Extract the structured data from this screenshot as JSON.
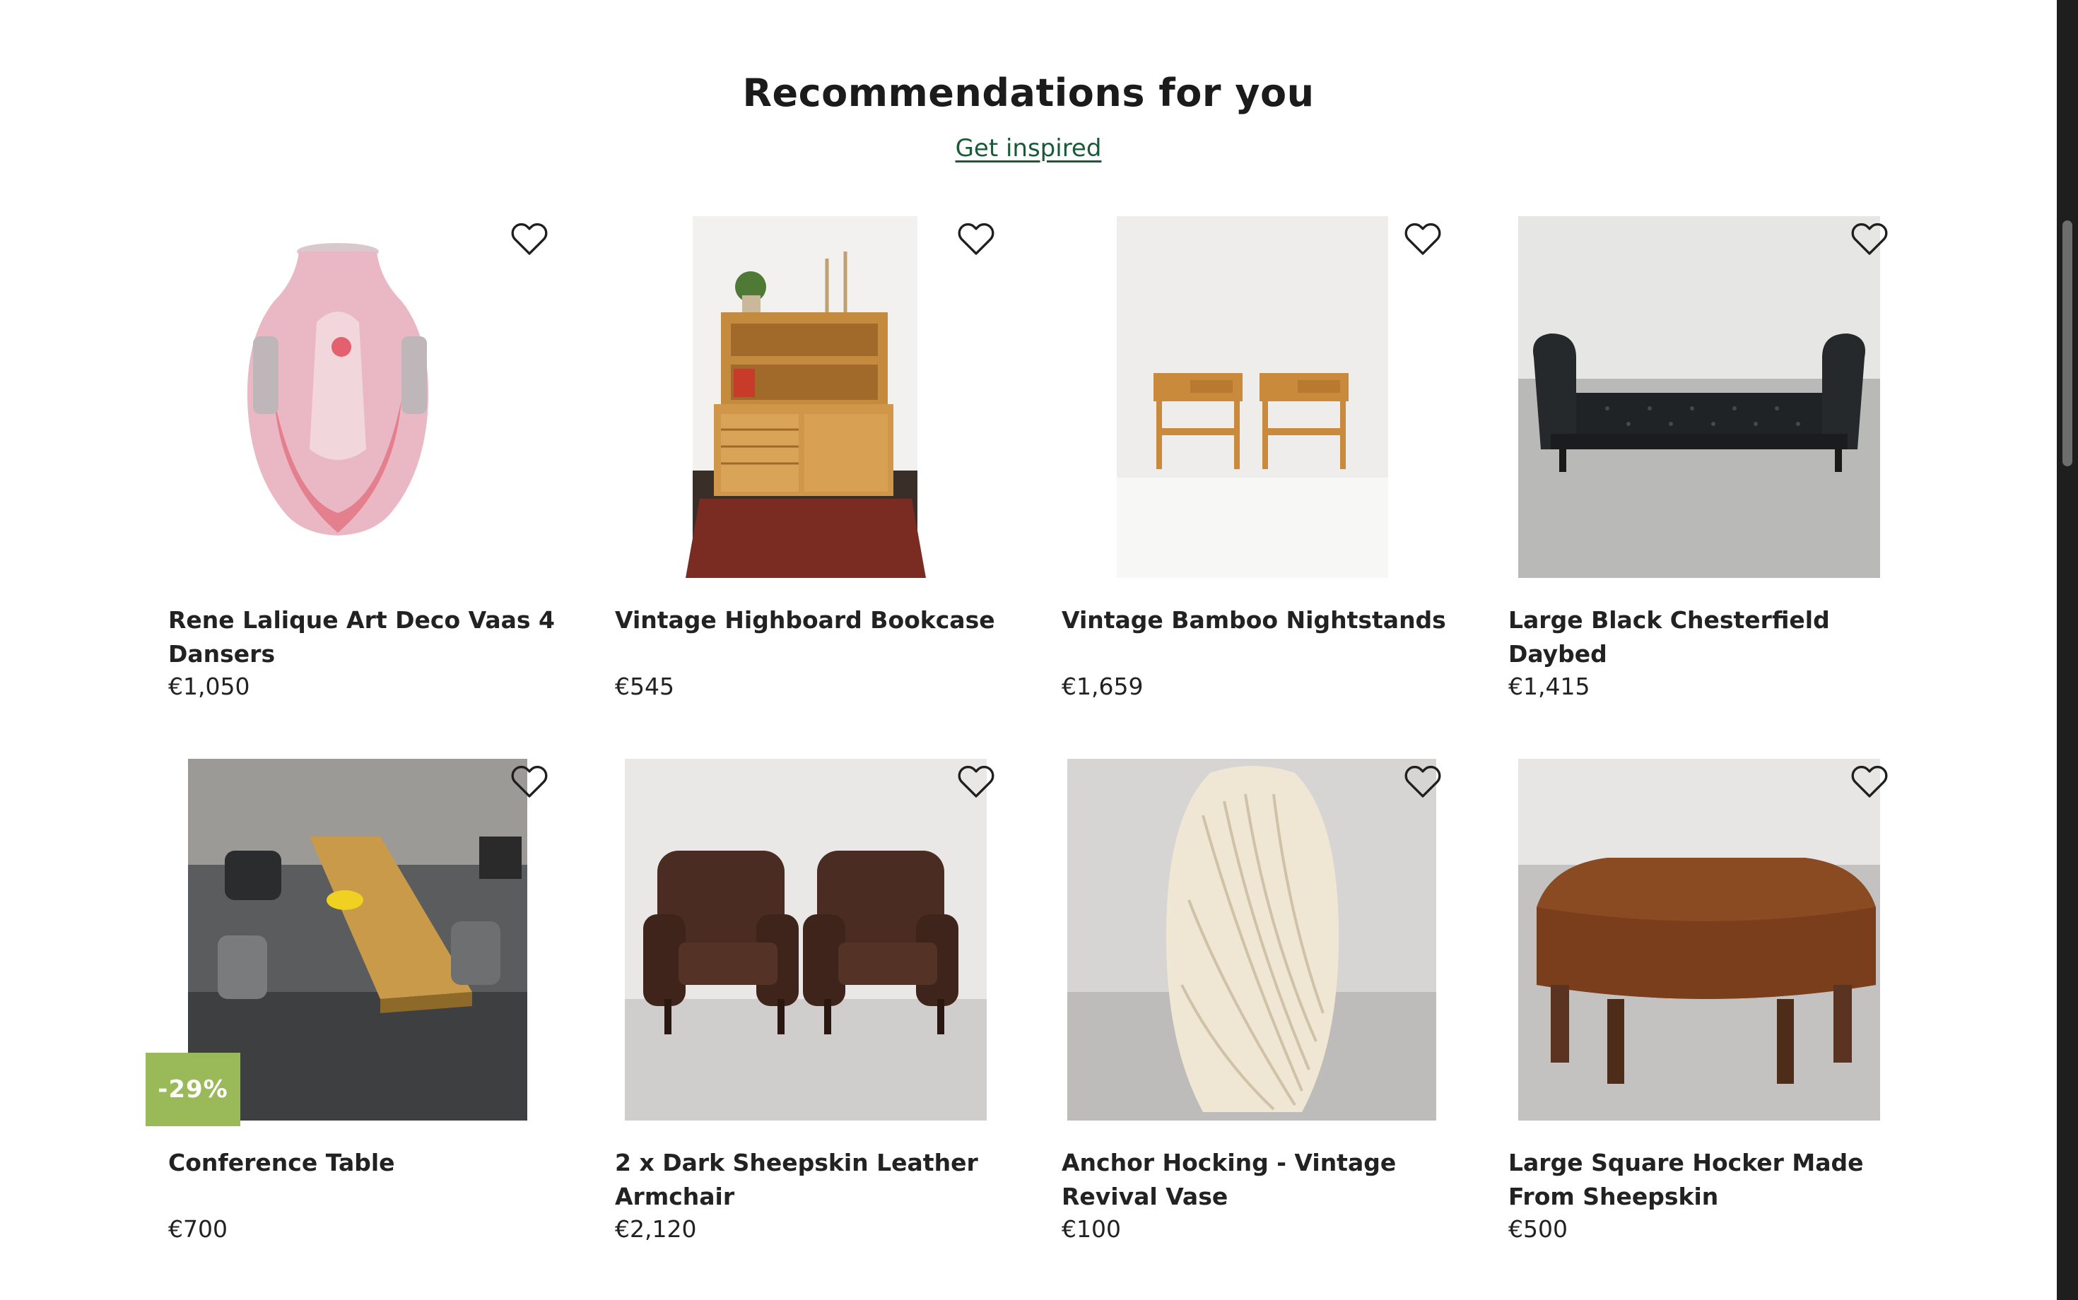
{
  "section": {
    "title": "Recommendations for you",
    "link": "Get inspired"
  },
  "products": [
    {
      "title": "Rene Lalique Art Deco Vaas 4 Dansers",
      "price": "€1,050"
    },
    {
      "title": "Vintage Highboard Bookcase",
      "price": "€545"
    },
    {
      "title": "Vintage Bamboo Nightstands",
      "price": "€1,659"
    },
    {
      "title": "Large Black Chesterfield Daybed",
      "price": "€1,415"
    },
    {
      "title": "Conference Table",
      "price": "€700",
      "discount": "-29%"
    },
    {
      "title": "2 x Dark Sheepskin Leather Armchair",
      "price": "€2,120"
    },
    {
      "title": "Anchor Hocking - Vintage Revival Vase",
      "price": "€100"
    },
    {
      "title": "Large Square Hocker Made From Sheepskin",
      "price": "€500"
    }
  ],
  "colors": {
    "accent_link": "#1a5a38",
    "discount_badge": "#9aba5a"
  },
  "icons": {
    "favorite": "heart-outline-icon"
  }
}
